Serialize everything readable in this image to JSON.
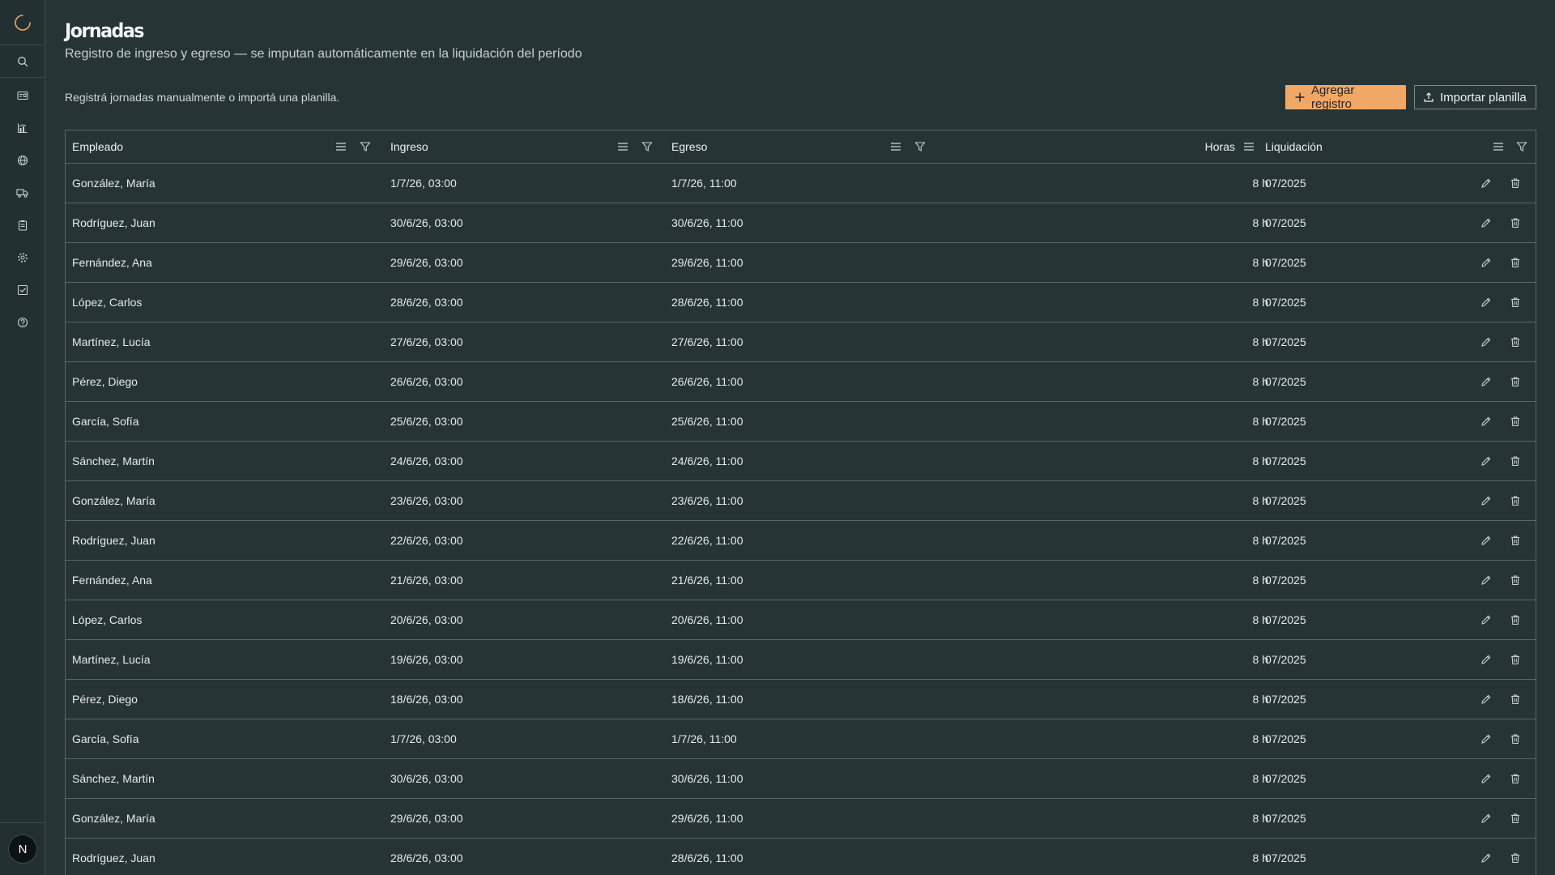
{
  "app": {
    "logo_icon": "loading-spinner-icon",
    "accent_color": "#f1a867",
    "background_color": "#263436"
  },
  "sidebar": {
    "search_icon": "search-icon",
    "items": [
      {
        "icon": "id-card-icon"
      },
      {
        "icon": "chart-icon"
      },
      {
        "icon": "globe-icon"
      },
      {
        "icon": "truck-icon"
      },
      {
        "icon": "clipboard-icon"
      },
      {
        "icon": "gear-icon"
      },
      {
        "icon": "checkbox-icon"
      },
      {
        "icon": "help-icon"
      }
    ],
    "avatar_letter": "N"
  },
  "header": {
    "title": "Jornadas",
    "subtitle": "Registro de ingreso y egreso — se imputan automáticamente en la liquidación del período"
  },
  "toolbar": {
    "hint": "Registrá jornadas manualmente o importá una planilla.",
    "add_label": "Agregar registro",
    "import_label": "Importar planilla"
  },
  "table": {
    "columns": [
      "Empleado",
      "Ingreso",
      "Egreso",
      "Horas",
      "Liquidación"
    ],
    "rows": [
      {
        "empleado": "González, María",
        "ingreso": "1/7/26, 03:00",
        "egreso": "1/7/26, 11:00",
        "horas": "8 h",
        "liquidacion": "07/2025"
      },
      {
        "empleado": "Rodríguez, Juan",
        "ingreso": "30/6/26, 03:00",
        "egreso": "30/6/26, 11:00",
        "horas": "8 h",
        "liquidacion": "07/2025"
      },
      {
        "empleado": "Fernández, Ana",
        "ingreso": "29/6/26, 03:00",
        "egreso": "29/6/26, 11:00",
        "horas": "8 h",
        "liquidacion": "07/2025"
      },
      {
        "empleado": "López, Carlos",
        "ingreso": "28/6/26, 03:00",
        "egreso": "28/6/26, 11:00",
        "horas": "8 h",
        "liquidacion": "07/2025"
      },
      {
        "empleado": "Martínez, Lucía",
        "ingreso": "27/6/26, 03:00",
        "egreso": "27/6/26, 11:00",
        "horas": "8 h",
        "liquidacion": "07/2025"
      },
      {
        "empleado": "Pérez, Diego",
        "ingreso": "26/6/26, 03:00",
        "egreso": "26/6/26, 11:00",
        "horas": "8 h",
        "liquidacion": "07/2025"
      },
      {
        "empleado": "García, Sofía",
        "ingreso": "25/6/26, 03:00",
        "egreso": "25/6/26, 11:00",
        "horas": "8 h",
        "liquidacion": "07/2025"
      },
      {
        "empleado": "Sánchez, Martín",
        "ingreso": "24/6/26, 03:00",
        "egreso": "24/6/26, 11:00",
        "horas": "8 h",
        "liquidacion": "07/2025"
      },
      {
        "empleado": "González, María",
        "ingreso": "23/6/26, 03:00",
        "egreso": "23/6/26, 11:00",
        "horas": "8 h",
        "liquidacion": "07/2025"
      },
      {
        "empleado": "Rodríguez, Juan",
        "ingreso": "22/6/26, 03:00",
        "egreso": "22/6/26, 11:00",
        "horas": "8 h",
        "liquidacion": "07/2025"
      },
      {
        "empleado": "Fernández, Ana",
        "ingreso": "21/6/26, 03:00",
        "egreso": "21/6/26, 11:00",
        "horas": "8 h",
        "liquidacion": "07/2025"
      },
      {
        "empleado": "López, Carlos",
        "ingreso": "20/6/26, 03:00",
        "egreso": "20/6/26, 11:00",
        "horas": "8 h",
        "liquidacion": "07/2025"
      },
      {
        "empleado": "Martínez, Lucía",
        "ingreso": "19/6/26, 03:00",
        "egreso": "19/6/26, 11:00",
        "horas": "8 h",
        "liquidacion": "07/2025"
      },
      {
        "empleado": "Pérez, Diego",
        "ingreso": "18/6/26, 03:00",
        "egreso": "18/6/26, 11:00",
        "horas": "8 h",
        "liquidacion": "07/2025"
      },
      {
        "empleado": "García, Sofía",
        "ingreso": "1/7/26, 03:00",
        "egreso": "1/7/26, 11:00",
        "horas": "8 h",
        "liquidacion": "07/2025"
      },
      {
        "empleado": "Sánchez, Martín",
        "ingreso": "30/6/26, 03:00",
        "egreso": "30/6/26, 11:00",
        "horas": "8 h",
        "liquidacion": "07/2025"
      },
      {
        "empleado": "González, María",
        "ingreso": "29/6/26, 03:00",
        "egreso": "29/6/26, 11:00",
        "horas": "8 h",
        "liquidacion": "07/2025"
      },
      {
        "empleado": "Rodríguez, Juan",
        "ingreso": "28/6/26, 03:00",
        "egreso": "28/6/26, 11:00",
        "horas": "8 h",
        "liquidacion": "07/2025"
      }
    ]
  }
}
